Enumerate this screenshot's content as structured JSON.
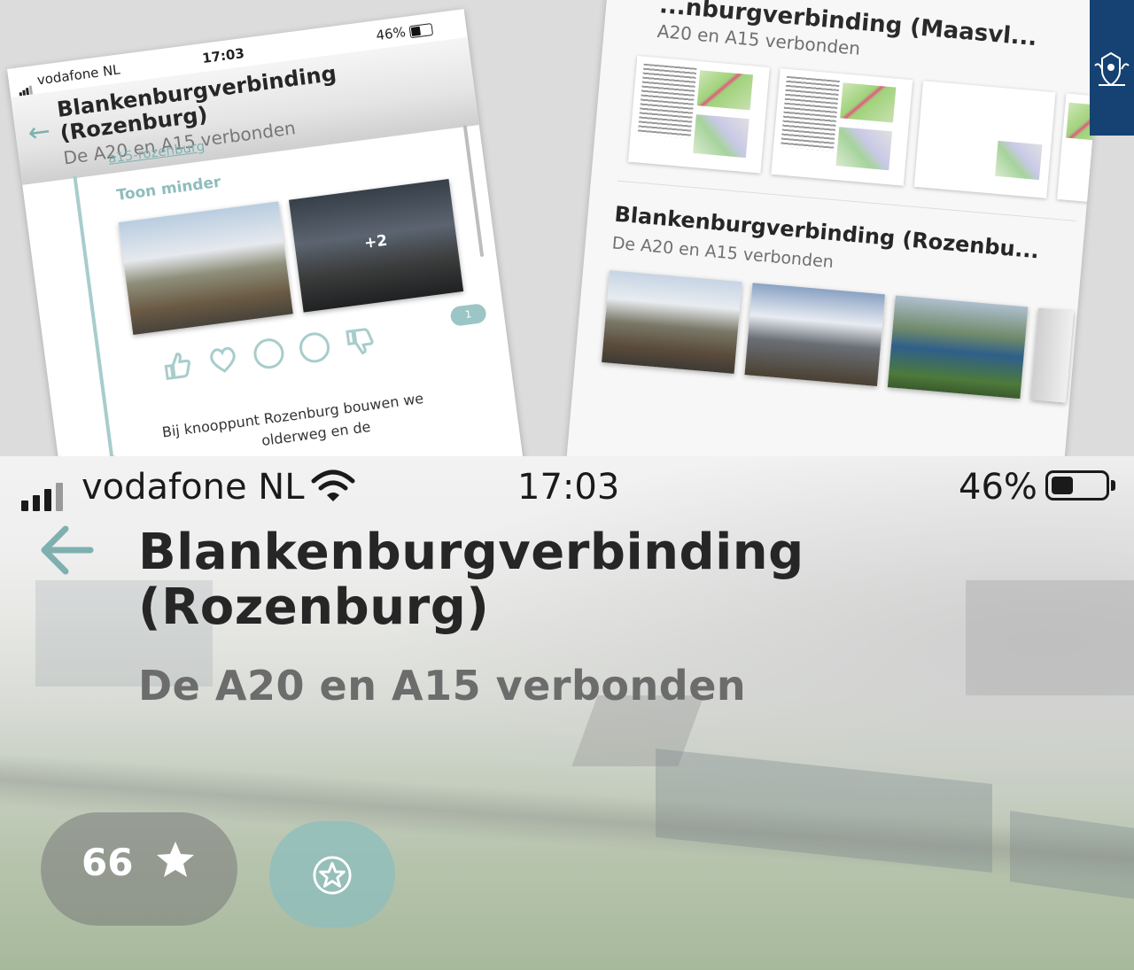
{
  "top_left_screenshot": {
    "status": {
      "carrier": "vodafone NL",
      "time": "17:03",
      "battery": "46%"
    },
    "title_line1": "Blankenburgverbinding",
    "title_line2": "(Rozenburg)",
    "subtitle": "De A20 en A15 verbonden",
    "link_text": "a15-rozenburg",
    "toggle_label": "Toon minder",
    "more_photos": "+2",
    "badge_count": "1",
    "body_line1": "Bij knooppunt Rozenburg bouwen we",
    "body_line2": "olderweg en de",
    "reactions": [
      "thumbs-up-icon",
      "heart-icon",
      "thinking-icon",
      "sad-icon",
      "thumbs-down-icon"
    ]
  },
  "top_right_screenshot": {
    "top_title": "...nburgverbinding (Maasvl...",
    "top_subtitle": "A20 en A15 verbonden",
    "card_title": "Blankenburgverbinding (Rozenbu...",
    "card_subtitle": "De A20 en A15 verbonden"
  },
  "main": {
    "status": {
      "carrier": "vodafone NL",
      "time": "17:03",
      "battery": "46%"
    },
    "title_line1": "Blankenburgverbinding",
    "title_line2": "(Rozenburg)",
    "subtitle": "De A20 en A15 verbonden",
    "rating_count": "66",
    "colors": {
      "accent": "#7fb0b0",
      "title": "#262626",
      "subtitle": "#6c6c6c",
      "emblem": "#154273"
    }
  }
}
